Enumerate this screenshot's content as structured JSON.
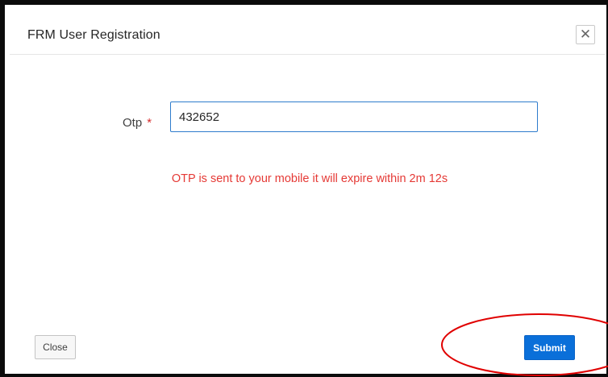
{
  "dialog": {
    "title": "FRM User Registration",
    "close_icon": "close-icon"
  },
  "form": {
    "otp_label": "Otp",
    "required_marker": "*",
    "otp_value": "432652",
    "message": "OTP is sent to your mobile it will expire within 2m 12s"
  },
  "footer": {
    "close_label": "Close",
    "submit_label": "Submit"
  },
  "colors": {
    "primary": "#0a6fd9",
    "error": "#e53935",
    "annotation": "#e00000"
  }
}
